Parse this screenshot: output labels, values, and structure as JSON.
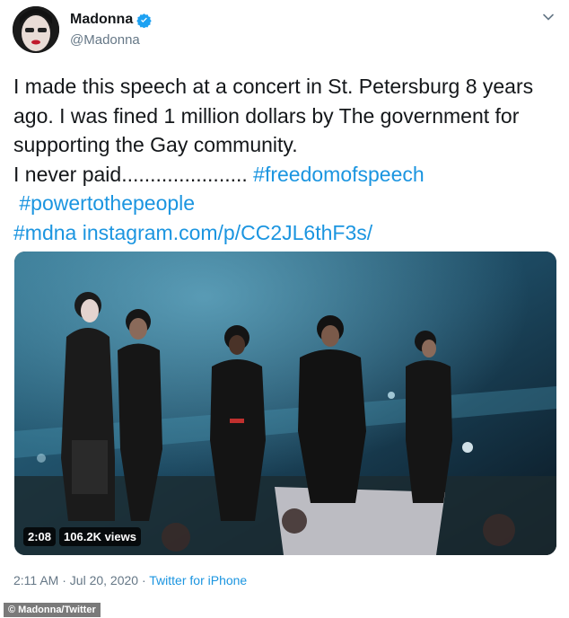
{
  "user": {
    "name": "Madonna",
    "handle": "@Madonna",
    "avatar_icon": "profile-photo",
    "verified_icon": "verified-badge-icon"
  },
  "tweet": {
    "lines": [
      "I made this speech at a concert in St. Petersburg 8 years",
      "ago. I was fined 1 million dollars by The government for",
      "supporting the Gay community."
    ],
    "line4_text": "I never paid......................",
    "hashtag_1": "#freedomofspeech",
    "hashtag_2": "#powertothepeople",
    "hashtag_3": "#mdna",
    "link": "instagram.com/p/CC2JL6thF3s/"
  },
  "video": {
    "duration": "2:08",
    "views": "106.2K views"
  },
  "meta": {
    "time": "2:11 AM",
    "separator_1": "·",
    "date": "Jul 20, 2020",
    "separator_2": "·",
    "source": "Twitter for iPhone"
  },
  "credit": "© Madonna/Twitter",
  "colors": {
    "link": "#1b95e0",
    "muted": "#657786",
    "verified": "#1da1f2"
  }
}
